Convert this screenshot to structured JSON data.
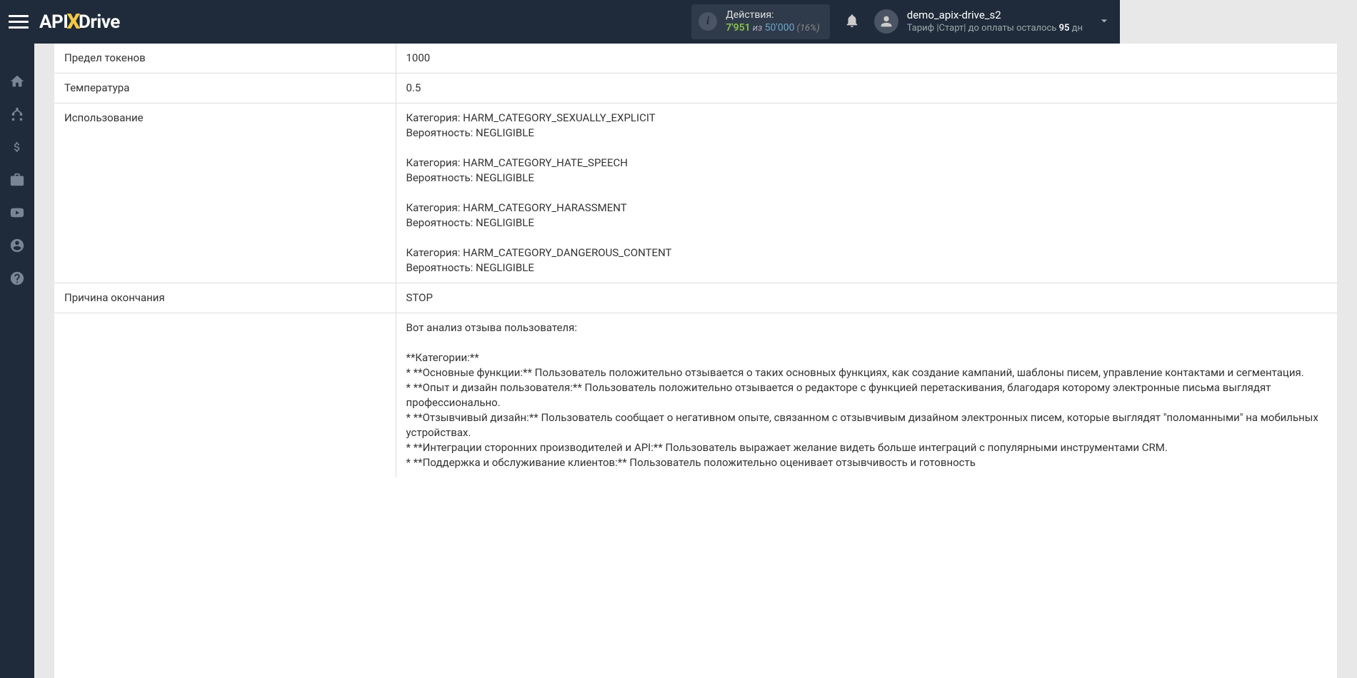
{
  "topbar": {
    "logo_api": "API",
    "logo_x": "X",
    "logo_drive": "Drive",
    "actions_label": "Действия:",
    "actions_current": "7'951",
    "actions_of": " из ",
    "actions_max": "50'000",
    "actions_pct": " (16%)",
    "user_name": "demo_apix-drive_s2",
    "tariff_prefix": "Тариф |Старт| до оплаты осталось ",
    "tariff_days": "95",
    "tariff_suffix": " дн"
  },
  "rows": {
    "token_limit_key": "Предел токенов",
    "token_limit_val": "1000",
    "temperature_key": "Температура",
    "temperature_val": "0.5",
    "usage_key": "Использование",
    "usage_val": "Категория: HARM_CATEGORY_SEXUALLY_EXPLICIT\nВероятность: NEGLIGIBLE\n\nКатегория: HARM_CATEGORY_HATE_SPEECH\nВероятность: NEGLIGIBLE\n\nКатегория: HARM_CATEGORY_HARASSMENT\nВероятность: NEGLIGIBLE\n\nКатегория: HARM_CATEGORY_DANGEROUS_CONTENT\nВероятность: NEGLIGIBLE",
    "finish_reason_key": "Причина окончания",
    "finish_reason_val": "STOP",
    "response_val": "Вот анализ отзыва пользователя:\n\n**Категории:**\n* **Основные функции:** Пользователь положительно отзывается о таких основных функциях, как создание кампаний, шаблоны писем, управление контактами и сегментация.\n* **Опыт и дизайн пользователя:** Пользователь положительно отзывается о редакторе с функцией перетаскивания, благодаря которому электронные письма выглядят профессионально.\n* **Отзывчивый дизайн:** Пользователь сообщает о негативном опыте, связанном с отзывчивым дизайном электронных писем, которые выглядят \"поломанными\" на мобильных устройствах.\n* **Интеграции сторонних производителей и API:** Пользователь выражает желание видеть больше интеграций с популярными инструментами CRM.\n* **Поддержка и обслуживание клиентов:** Пользователь положительно оценивает отзывчивость и готовность"
  }
}
